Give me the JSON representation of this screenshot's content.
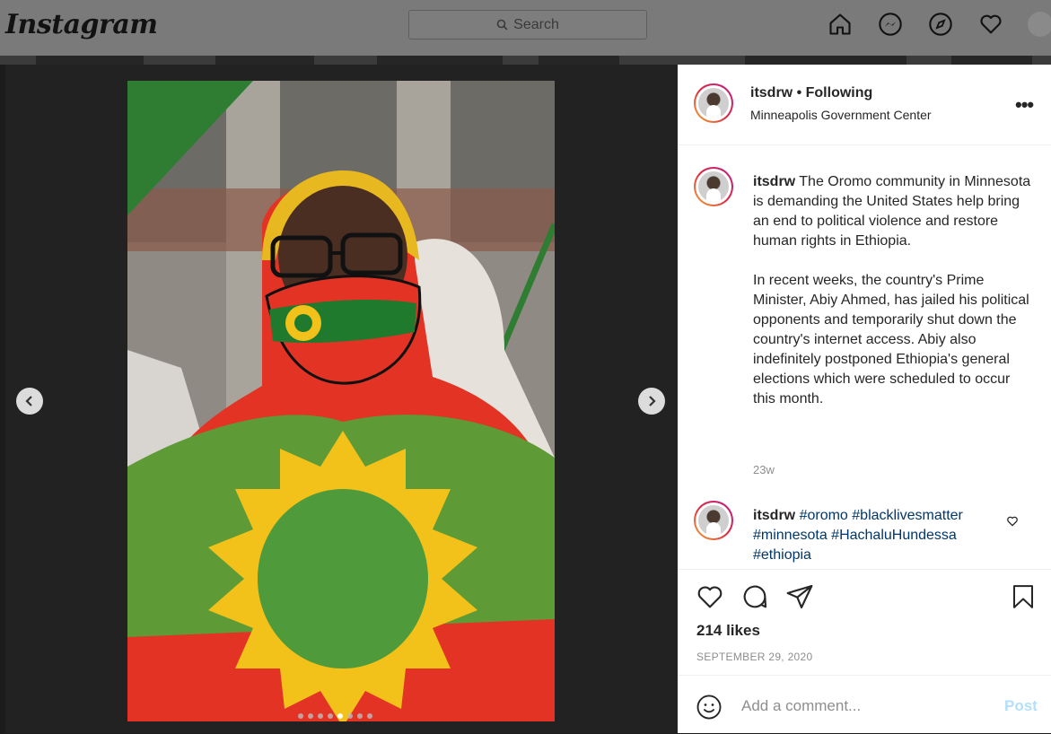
{
  "app": {
    "logo_text": "Instagram"
  },
  "nav": {
    "search_placeholder": "Search",
    "icons": [
      "home-icon",
      "messenger-icon",
      "explore-compass-icon",
      "activity-heart-icon",
      "profile-avatar"
    ]
  },
  "post": {
    "username": "itsdrw",
    "follow_status": "• Following",
    "location": "Minneapolis Government Center",
    "caption_p1": "The Oromo community in Minnesota is demanding the United States help bring an end to political violence and restore human rights in Ethiopia.",
    "caption_p2": "In recent weeks, the country's Prime Minister, Abiy Ahmed, has jailed his political opponents and temporarily shut down the country's internet access. Abiy also indefinitely postponed Ethiopia's general elections which were scheduled to occur this month.",
    "caption_time": "23w",
    "comment": {
      "username": "itsdrw",
      "hashtags": [
        "#oromo",
        "#blacklivesmatter",
        "#minnesota",
        "#HachaluHundessa",
        "#ethiopia"
      ]
    },
    "likes": "214 likes",
    "date": "SEPTEMBER 29, 2020",
    "carousel": {
      "total": 8,
      "current": 5
    },
    "add_comment_placeholder": "Add a comment...",
    "post_label": "Post"
  },
  "colors": {
    "ring_gradient": [
      "#f9b232",
      "#e6683c",
      "#dc2743",
      "#cc2366",
      "#bc1888"
    ],
    "hashtag": "#00376b",
    "post_disabled": "#b2dffc",
    "muted": "#8e8e8e"
  }
}
